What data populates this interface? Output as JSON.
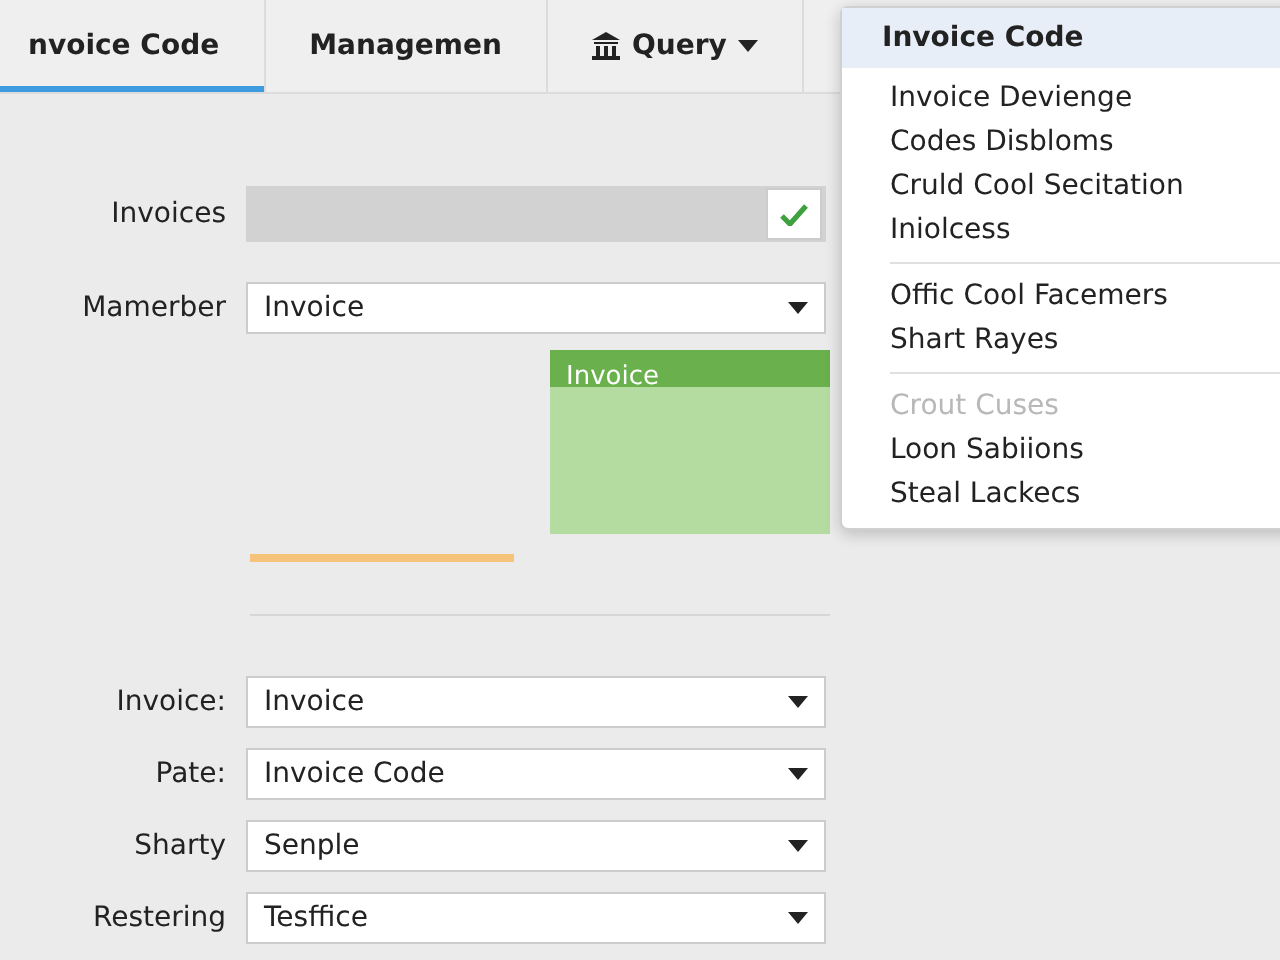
{
  "tabs": [
    {
      "label": "nvoice Code",
      "selected": true,
      "kind": "plain"
    },
    {
      "label": "Managemen",
      "selected": false,
      "kind": "plain"
    },
    {
      "label": "Query",
      "selected": false,
      "kind": "menu"
    }
  ],
  "top_form": {
    "invoices": {
      "label": "Invoices",
      "checked": true
    },
    "member": {
      "label": "Mamerber",
      "value": "Invoice"
    },
    "action_button": {
      "label": "Invoice"
    }
  },
  "bottom_form": [
    {
      "label": "Invoice:",
      "value": "Invoice"
    },
    {
      "label": "Pate:",
      "value": "Invoice Code"
    },
    {
      "label": "Sharty",
      "value": "Senple"
    },
    {
      "label": "Restering",
      "value": "Tesffice"
    }
  ],
  "dropdown_menu": {
    "header": "Invoice Code",
    "groups": [
      [
        {
          "label": "Invoice Devienge",
          "disabled": false
        },
        {
          "label": "Codes Disbloms",
          "disabled": false
        },
        {
          "label": "Cruld Cool Secitation",
          "disabled": false
        },
        {
          "label": "Iniolcess",
          "disabled": false
        }
      ],
      [
        {
          "label": "Offic Cool Facemers",
          "disabled": false
        },
        {
          "label": "Shart Rayes",
          "disabled": false
        }
      ],
      [
        {
          "label": "Crout Cuses",
          "disabled": true
        },
        {
          "label": "Loon Sabiions",
          "disabled": false
        },
        {
          "label": "Steal Lackecs",
          "disabled": false
        }
      ]
    ]
  }
}
